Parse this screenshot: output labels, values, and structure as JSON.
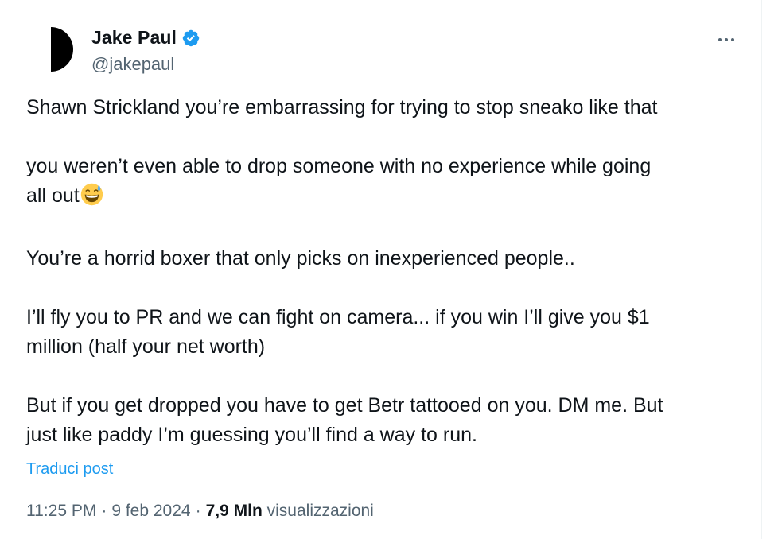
{
  "author": {
    "display_name": "Jake Paul",
    "handle": "@jakepaul",
    "verified": true,
    "verified_color": "#1d9bf0",
    "avatar_icon": "half-moon-logo"
  },
  "menu_icon": "more-horizontal-icon",
  "tweet": {
    "paragraph_1": "Shawn Strickland you’re embarrassing for trying to stop sneako like that",
    "paragraph_2_line_1": "you weren’t even able to drop someone with no experience while going",
    "paragraph_2_line_2": "all out",
    "paragraph_2_emoji": "grinning-face-with-sweat-emoji",
    "paragraph_3": "You’re a horrid boxer that only picks on inexperienced people..",
    "paragraph_4_line_1": "I’ll fly you to PR and we can fight on camera... if you win I’ll give you $1",
    "paragraph_4_line_2": "million (half your net worth)",
    "paragraph_5_line_1": "But if you get dropped you have to get Betr tattooed on you. DM me. But",
    "paragraph_5_line_2": "just like paddy I’m guessing you’ll find a way to run."
  },
  "translate_label": "Traduci post",
  "meta": {
    "time": "11:25 PM",
    "date": "9 feb 2024",
    "views_count": "7,9 Mln",
    "views_label": "visualizzazioni",
    "separator": "·"
  },
  "colors": {
    "text": "#0f1419",
    "secondary": "#536471",
    "link": "#1d9bf0"
  }
}
